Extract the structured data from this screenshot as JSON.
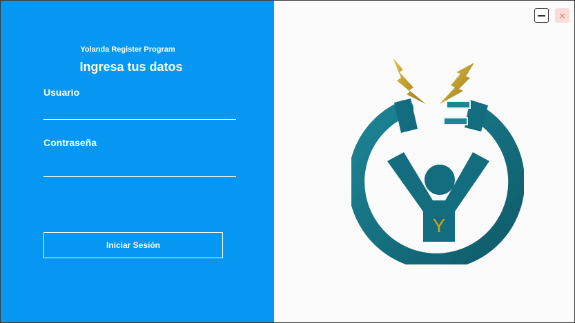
{
  "window": {
    "app_name": "Yolanda Register Program",
    "heading": "Ingresa tus datos"
  },
  "form": {
    "username_label": "Usuario",
    "username_value": "",
    "password_label": "Contraseña",
    "password_value": "",
    "login_button": "Iniciar Sesión"
  },
  "controls": {
    "minimize_icon": "minimize-icon",
    "close_icon": "close-icon",
    "close_glyph": "×"
  },
  "logo": {
    "letter": "Y",
    "icon": "plug-person-logo",
    "colors": {
      "ring": "#136d7e",
      "bolt": "#c9a226",
      "letter": "#d6a018"
    }
  },
  "theme": {
    "primary": "#0597f2",
    "background": "#fbfbfb"
  }
}
